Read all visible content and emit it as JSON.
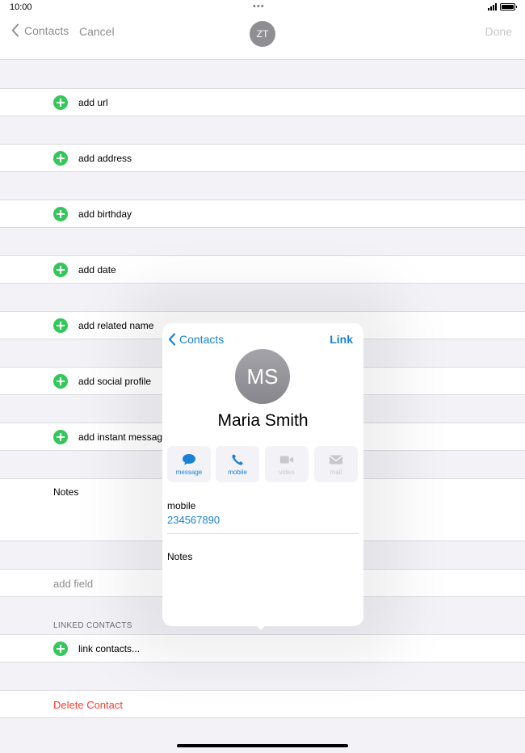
{
  "status_bar": {
    "time": "10:00",
    "dots": "•••"
  },
  "nav": {
    "back_label": "Contacts",
    "cancel_label": "Cancel",
    "avatar_initials": "ZT",
    "done_label": "Done"
  },
  "rows": {
    "add_url": "add url",
    "add_address": "add address",
    "add_birthday": "add birthday",
    "add_date": "add date",
    "add_related_name": "add related name",
    "add_social_profile": "add social profile",
    "add_instant_message": "add instant message",
    "notes": "Notes",
    "add_field": "add field",
    "linked_contacts_header": "LINKED CONTACTS",
    "link_contacts": "link contacts...",
    "delete_contact": "Delete Contact"
  },
  "popover": {
    "back_label": "Contacts",
    "link_label": "Link",
    "avatar_initials": "MS",
    "name": "Maria Smith",
    "actions": [
      {
        "label": "message",
        "icon": "message-bubble-icon",
        "enabled": true
      },
      {
        "label": "mobile",
        "icon": "phone-icon",
        "enabled": true
      },
      {
        "label": "video",
        "icon": "video-camera-icon",
        "enabled": false
      },
      {
        "label": "mail",
        "icon": "envelope-icon",
        "enabled": false
      }
    ],
    "phone_label": "mobile",
    "phone_value": "234567890",
    "notes_label": "Notes"
  },
  "colors": {
    "accent_blue": "#1a82d6",
    "add_green": "#34c759",
    "destructive_red": "#ff3b30",
    "grouped_background": "#f2f2f7"
  }
}
